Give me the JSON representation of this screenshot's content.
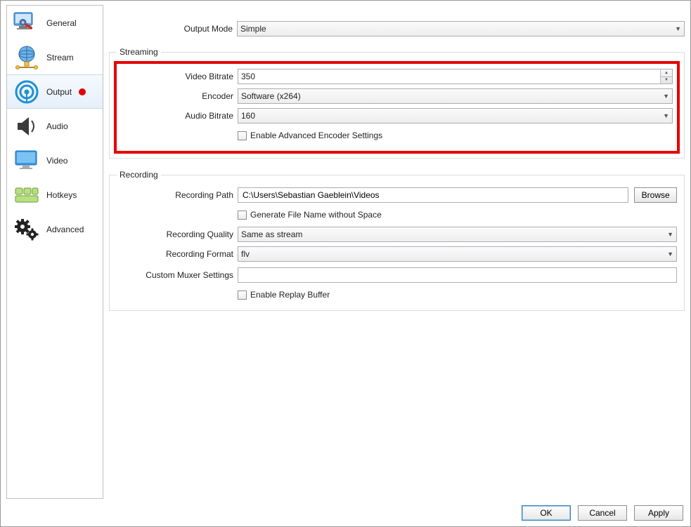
{
  "sidebar": {
    "items": [
      {
        "label": "General"
      },
      {
        "label": "Stream"
      },
      {
        "label": "Output"
      },
      {
        "label": "Audio"
      },
      {
        "label": "Video"
      },
      {
        "label": "Hotkeys"
      },
      {
        "label": "Advanced"
      }
    ]
  },
  "top": {
    "output_mode_label": "Output Mode",
    "output_mode_value": "Simple"
  },
  "streaming": {
    "legend": "Streaming",
    "video_bitrate_label": "Video Bitrate",
    "video_bitrate_value": "350",
    "encoder_label": "Encoder",
    "encoder_value": "Software (x264)",
    "audio_bitrate_label": "Audio Bitrate",
    "audio_bitrate_value": "160",
    "enable_advanced_label": "Enable Advanced Encoder Settings"
  },
  "recording": {
    "legend": "Recording",
    "recording_path_label": "Recording Path",
    "recording_path_value": "C:\\Users\\Sebastian Gaeblein\\Videos",
    "browse_label": "Browse",
    "generate_filename_label": "Generate File Name without Space",
    "recording_quality_label": "Recording Quality",
    "recording_quality_value": "Same as stream",
    "recording_format_label": "Recording Format",
    "recording_format_value": "flv",
    "custom_muxer_label": "Custom Muxer Settings",
    "custom_muxer_value": "",
    "enable_replay_label": "Enable Replay Buffer"
  },
  "footer": {
    "ok": "OK",
    "cancel": "Cancel",
    "apply": "Apply"
  }
}
